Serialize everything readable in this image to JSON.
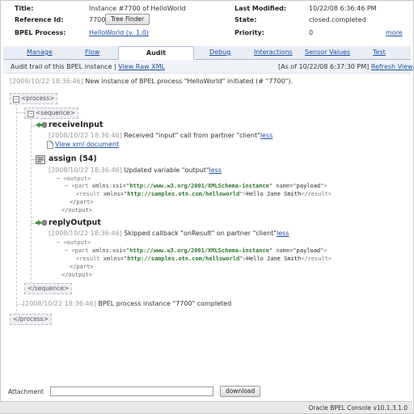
{
  "header": {
    "title_label": "Title:",
    "title_value": "Instance #7700 of HelloWorld",
    "refid_label": "Reference Id:",
    "refid_value": "7700",
    "tree_finder_button": "Tree Finder",
    "bpel_label": "BPEL Process:",
    "bpel_link": "HelloWorld (v. 1.0)",
    "modified_label": "Last Modified:",
    "modified_value": "10/22/08 6:36:46 PM",
    "state_label": "State:",
    "state_value": "closed.completed",
    "priority_label": "Priority:",
    "priority_value": "0",
    "more_link": "more"
  },
  "tabs": [
    "Manage",
    "Flow",
    "Audit",
    "Debug",
    "Interactions",
    "Sensor Values",
    "Test"
  ],
  "active_tab": "Audit",
  "subbar": {
    "prefix": "Audit trail of this BPEL instance |",
    "raw_xml_link": "View Raw XML",
    "as_of": "[As of 10/22/08 6:37:30 PM]",
    "refresh_link": "Refresh View"
  },
  "audit": {
    "start_ts": "[2008/10/22 18:36:46]",
    "start_msg": "New instance of BPEL process \"HelloWorld\" initiated (# \"7700\").",
    "process_open": "<process>",
    "sequence_open": "<sequence>",
    "receive": {
      "name": "receiveInput",
      "ts": "[2008/10/22 18:36:46]",
      "msg": "Received \"input\" call from partner \"client\"",
      "less": "less",
      "xml_link": "View xml document"
    },
    "assign": {
      "name": "assign (54)",
      "ts": "[2008/10/22 18:36:46]",
      "msg": "Updated variable \"output\"",
      "less": "less"
    },
    "reply": {
      "name": "replyOutput",
      "ts": "[2008/10/22 18:36:46]",
      "msg": "Skipped callback \"onResult\" on partner \"client\"",
      "less": "less"
    },
    "xml": {
      "output_open": "<output>",
      "part_attr": "xmlns:xsi",
      "part_xsi_ns": "http://www.w3.org/2001/XMLSchema-instance",
      "part_name_attr": "name",
      "part_name": "payload",
      "result_attr": "xmlns",
      "result_ns": "http://samples.otn.com/helloworld",
      "result_text": "Hello Jane Smith",
      "part_close": "</part>",
      "output_close": "</output>"
    },
    "sequence_close": "</sequence>",
    "end_ts": "[2008/10/22 18:36:46]",
    "end_msg": "BPEL process instance \"7700\" completed",
    "process_close": "</process>"
  },
  "footer": {
    "attachment_label": "Attachment",
    "download_button": "download",
    "version": "Oracle BPEL Console v10.1.3.1.0"
  }
}
